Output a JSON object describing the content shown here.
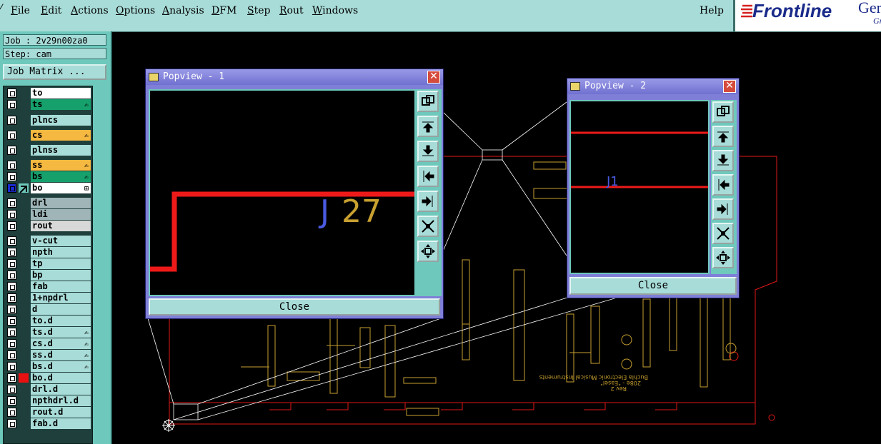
{
  "menu": {
    "items": [
      {
        "label": "File",
        "ul": "F"
      },
      {
        "label": "Edit",
        "ul": "E"
      },
      {
        "label": "Actions",
        "ul": "A"
      },
      {
        "label": "Options",
        "ul": "O"
      },
      {
        "label": "Analysis",
        "ul": "A"
      },
      {
        "label": "DFM",
        "ul": "D"
      },
      {
        "label": "Step",
        "ul": "S"
      },
      {
        "label": "Rout",
        "ul": "R"
      },
      {
        "label": "Windows",
        "ul": "W"
      }
    ],
    "help": "Help"
  },
  "brand": {
    "logo": "Frontline",
    "product_partial": "Ger",
    "tagline_partial": "Gr"
  },
  "job": {
    "job_line": "Job : 2v29n00za0",
    "step_line": "Step: cam",
    "matrix_button": "Job Matrix ..."
  },
  "layers": [
    {
      "name": "to",
      "color": "#ffffff"
    },
    {
      "name": "ts",
      "color": "#16a06c",
      "mark": "pen"
    },
    {
      "name": "plncs",
      "color": "#a8dcd8"
    },
    {
      "name": "cs",
      "color": "#f5b840",
      "mark": "pen"
    },
    {
      "name": "plnss",
      "color": "#a8dcd8"
    },
    {
      "name": "ss",
      "color": "#f5b840",
      "mark": "pen"
    },
    {
      "name": "bs",
      "color": "#16a06c",
      "mark": "pen"
    },
    {
      "name": "bo",
      "color": "#ffffff",
      "mark": "grid",
      "active": true
    },
    {
      "name": "drl",
      "color": "#9fb5b8"
    },
    {
      "name": "ldi",
      "color": "#9fb5b8"
    },
    {
      "name": "rout",
      "color": "#d8d8d8"
    },
    {
      "name": "v-cut",
      "color": "#a8dcd8"
    },
    {
      "name": "npth",
      "color": "#a8dcd8"
    },
    {
      "name": "tp",
      "color": "#a8dcd8"
    },
    {
      "name": "bp",
      "color": "#a8dcd8"
    },
    {
      "name": "fab",
      "color": "#a8dcd8"
    },
    {
      "name": "1+npdrl",
      "color": "#a8dcd8"
    },
    {
      "name": "d",
      "color": "#a8dcd8"
    },
    {
      "name": "to.d",
      "color": "#a8dcd8"
    },
    {
      "name": "ts.d",
      "color": "#a8dcd8",
      "mark": "pen"
    },
    {
      "name": "cs.d",
      "color": "#a8dcd8",
      "mark": "pen"
    },
    {
      "name": "ss.d",
      "color": "#a8dcd8",
      "mark": "pen"
    },
    {
      "name": "bs.d",
      "color": "#a8dcd8",
      "mark": "pen"
    },
    {
      "name": "bo.d",
      "color": "#a8dcd8",
      "swatch": "#e81010"
    },
    {
      "name": "drl.d",
      "color": "#a8dcd8"
    },
    {
      "name": "npthdrl.d",
      "color": "#a8dcd8"
    },
    {
      "name": "rout.d",
      "color": "#a8dcd8"
    },
    {
      "name": "fab.d",
      "color": "#a8dcd8"
    }
  ],
  "popview1": {
    "title": "Popview - 1",
    "close_label": "Close",
    "ref_prefix": "J",
    "ref_number": "27"
  },
  "popview2": {
    "title": "Popview - 2",
    "close_label": "Close",
    "ref_label": "J1"
  },
  "pcb": {
    "silkscreen_title": "Buchla Electronic Musical Instruments",
    "silkscreen_sub": "208e - \"Easel\"",
    "silkscreen_rev": "Rev 2"
  },
  "colors": {
    "panel": "#a8dcd8",
    "panel_dark": "#6ec8bc",
    "outline": "#e01818",
    "copper": "#c8a030",
    "silk_blue": "#4a5ae0"
  }
}
